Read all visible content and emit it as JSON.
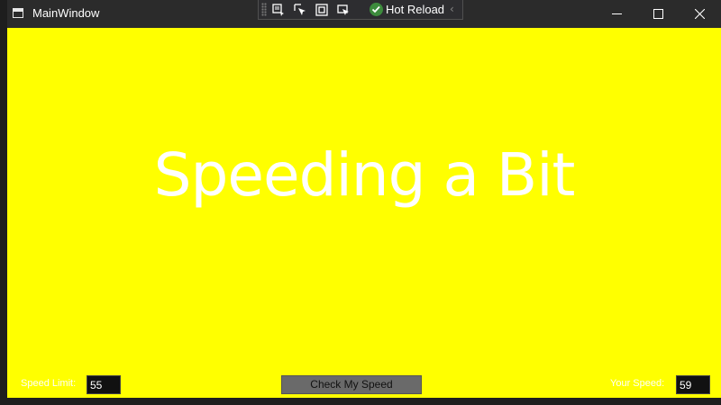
{
  "window": {
    "title": "MainWindow"
  },
  "devtools": {
    "hot_reload_label": "Hot Reload"
  },
  "main": {
    "message": "Speeding a Bit",
    "background_color": "#ffff00"
  },
  "controls": {
    "speed_limit_label": "Speed Limit:",
    "speed_limit_value": "55",
    "check_button_label": "Check My Speed",
    "your_speed_label": "Your Speed:",
    "your_speed_value": "59"
  }
}
